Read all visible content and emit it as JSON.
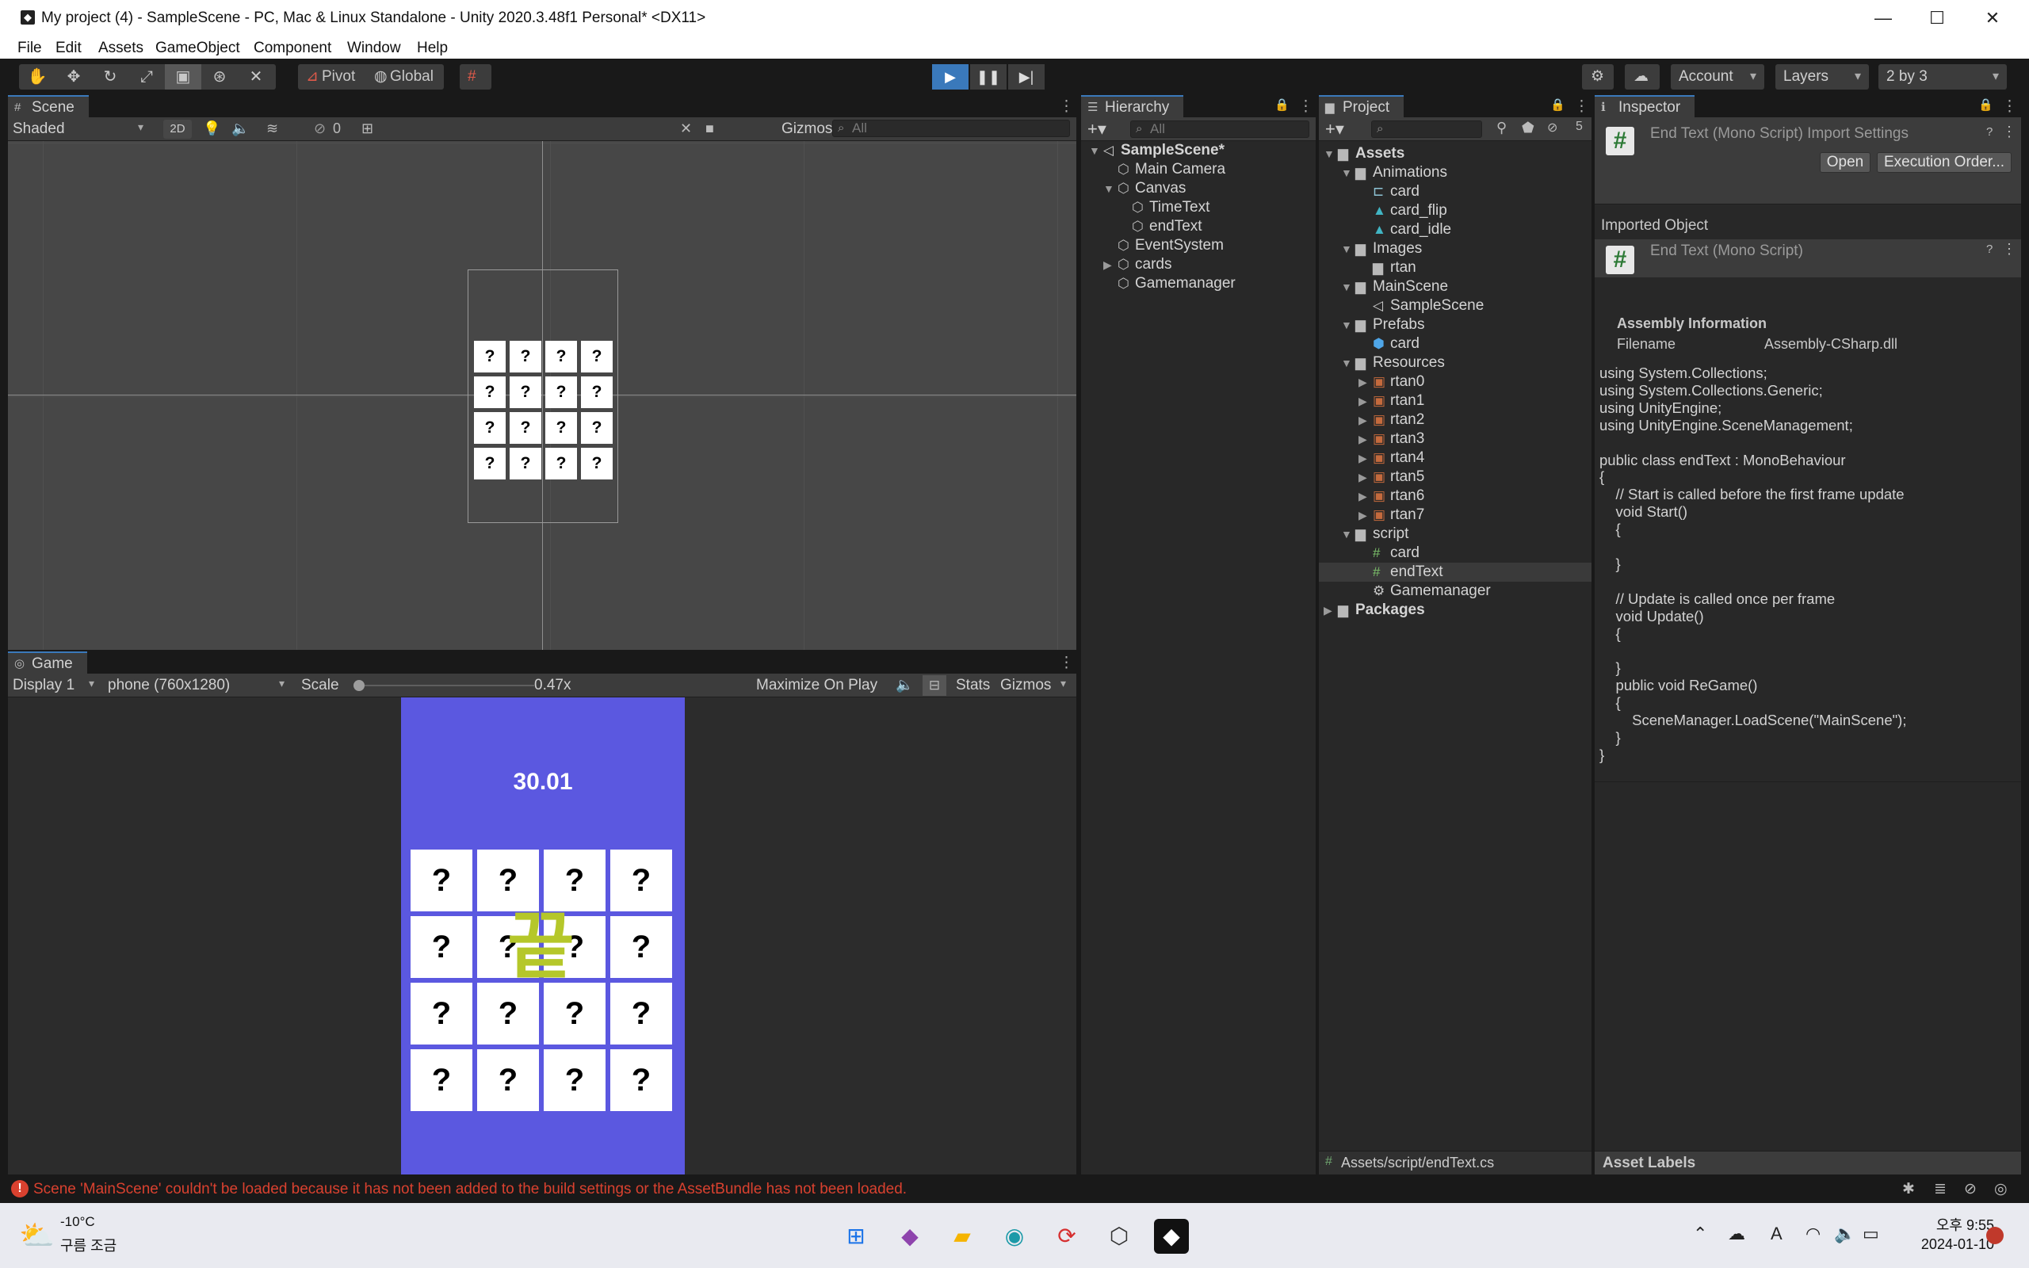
{
  "window": {
    "title": "My project (4) - SampleScene - PC, Mac & Linux Standalone - Unity 2020.3.48f1 Personal* <DX11>",
    "controls": {
      "minimize": "—",
      "maximize": "☐",
      "close": "✕"
    }
  },
  "menu": [
    "File",
    "Edit",
    "Assets",
    "GameObject",
    "Component",
    "Window",
    "Help"
  ],
  "toolbar": {
    "pivot": "Pivot",
    "global": "Global",
    "account": "Account",
    "layers": "Layers",
    "layout": "2 by 3"
  },
  "scene": {
    "tab": "Scene",
    "shading": "Shaded",
    "mode_2d": "2D",
    "hidden_count": "0",
    "gizmos": "Gizmos",
    "search_placeholder": "All",
    "card_glyph": "?"
  },
  "game": {
    "tab": "Game",
    "display": "Display 1",
    "resolution": "phone (760x1280)",
    "scale_label": "Scale",
    "scale_value": "0.47x",
    "scale_fraction": 0.0,
    "maximize": "Maximize On Play",
    "stats": "Stats",
    "gizmos": "Gizmos",
    "timer": "30.01",
    "end_text": "끝",
    "card_glyph": "?"
  },
  "hierarchy": {
    "tab": "Hierarchy",
    "search_placeholder": "All",
    "items": [
      {
        "label": "SampleScene*",
        "level": 0,
        "expanded": true,
        "icon": "unity-scene-icon"
      },
      {
        "label": "Main Camera",
        "level": 1,
        "icon": "gameobject-icon"
      },
      {
        "label": "Canvas",
        "level": 1,
        "expanded": true,
        "icon": "gameobject-icon"
      },
      {
        "label": "TimeText",
        "level": 2,
        "icon": "gameobject-icon"
      },
      {
        "label": "endText",
        "level": 2,
        "icon": "gameobject-icon"
      },
      {
        "label": "EventSystem",
        "level": 1,
        "icon": "gameobject-icon"
      },
      {
        "label": "cards",
        "level": 1,
        "collapsed": true,
        "icon": "gameobject-icon"
      },
      {
        "label": "Gamemanager",
        "level": 1,
        "icon": "gameobject-icon"
      }
    ]
  },
  "project": {
    "tab": "Project",
    "hidden_packages_count": "5",
    "path": "Assets/script/endText.cs",
    "tree": [
      {
        "label": "Assets",
        "level": 0,
        "expanded": true,
        "icon": "folder-icon"
      },
      {
        "label": "Animations",
        "level": 1,
        "expanded": true,
        "icon": "folder-icon"
      },
      {
        "label": "card",
        "level": 2,
        "icon": "animator-icon"
      },
      {
        "label": "card_flip",
        "level": 2,
        "icon": "animation-clip-icon"
      },
      {
        "label": "card_idle",
        "level": 2,
        "icon": "animation-clip-icon"
      },
      {
        "label": "Images",
        "level": 1,
        "expanded": true,
        "icon": "folder-icon"
      },
      {
        "label": "rtan",
        "level": 2,
        "icon": "folder-icon"
      },
      {
        "label": "MainScene",
        "level": 1,
        "expanded": true,
        "icon": "folder-icon"
      },
      {
        "label": "SampleScene",
        "level": 2,
        "icon": "unity-scene-icon"
      },
      {
        "label": "Prefabs",
        "level": 1,
        "expanded": true,
        "icon": "folder-icon"
      },
      {
        "label": "card",
        "level": 2,
        "icon": "prefab-icon"
      },
      {
        "label": "Resources",
        "level": 1,
        "expanded": true,
        "icon": "folder-icon"
      },
      {
        "label": "rtan0",
        "level": 2,
        "collapsed": true,
        "icon": "sprite-icon"
      },
      {
        "label": "rtan1",
        "level": 2,
        "collapsed": true,
        "icon": "sprite-icon"
      },
      {
        "label": "rtan2",
        "level": 2,
        "collapsed": true,
        "icon": "sprite-icon"
      },
      {
        "label": "rtan3",
        "level": 2,
        "collapsed": true,
        "icon": "sprite-icon"
      },
      {
        "label": "rtan4",
        "level": 2,
        "collapsed": true,
        "icon": "sprite-icon"
      },
      {
        "label": "rtan5",
        "level": 2,
        "collapsed": true,
        "icon": "sprite-icon"
      },
      {
        "label": "rtan6",
        "level": 2,
        "collapsed": true,
        "icon": "sprite-icon"
      },
      {
        "label": "rtan7",
        "level": 2,
        "collapsed": true,
        "icon": "sprite-icon"
      },
      {
        "label": "script",
        "level": 1,
        "expanded": true,
        "icon": "folder-icon"
      },
      {
        "label": "card",
        "level": 2,
        "icon": "csharp-script-icon"
      },
      {
        "label": "endText",
        "level": 2,
        "icon": "csharp-script-icon",
        "selected": true
      },
      {
        "label": "Gamemanager",
        "level": 2,
        "icon": "gear-icon"
      },
      {
        "label": "Packages",
        "level": 0,
        "collapsed": true,
        "icon": "folder-icon"
      }
    ]
  },
  "inspector": {
    "tab": "Inspector",
    "header": "End Text (Mono Script) Import Settings",
    "open": "Open",
    "execution_order": "Execution Order...",
    "imported_object": "Imported Object",
    "object_name": "End Text (Mono Script)",
    "assembly_heading": "Assembly Information",
    "filename_label": "Filename",
    "filename_value": "Assembly-CSharp.dll",
    "code": "using System.Collections;\nusing System.Collections.Generic;\nusing UnityEngine;\nusing UnityEngine.SceneManagement;\n\npublic class endText : MonoBehaviour\n{\n    // Start is called before the first frame update\n    void Start()\n    {\n\n    }\n\n    // Update is called once per frame\n    void Update()\n    {\n\n    }\n    public void ReGame()\n    {\n        SceneManager.LoadScene(\"MainScene\");\n    }\n}",
    "asset_labels": "Asset Labels"
  },
  "status": {
    "error": "Scene 'MainScene' couldn't be loaded because it has not been added to the build settings or the AssetBundle has not been loaded."
  },
  "taskbar": {
    "weather_temp": "-10°C",
    "weather_desc": "구름 조금",
    "clock_time": "오후 9:55",
    "clock_date": "2024-01-10",
    "ime": "A"
  },
  "colors": {
    "accent": "#3a79bb",
    "game_bg": "#5b58e0",
    "end_text": "#b5c72a",
    "error": "#d9412f"
  }
}
